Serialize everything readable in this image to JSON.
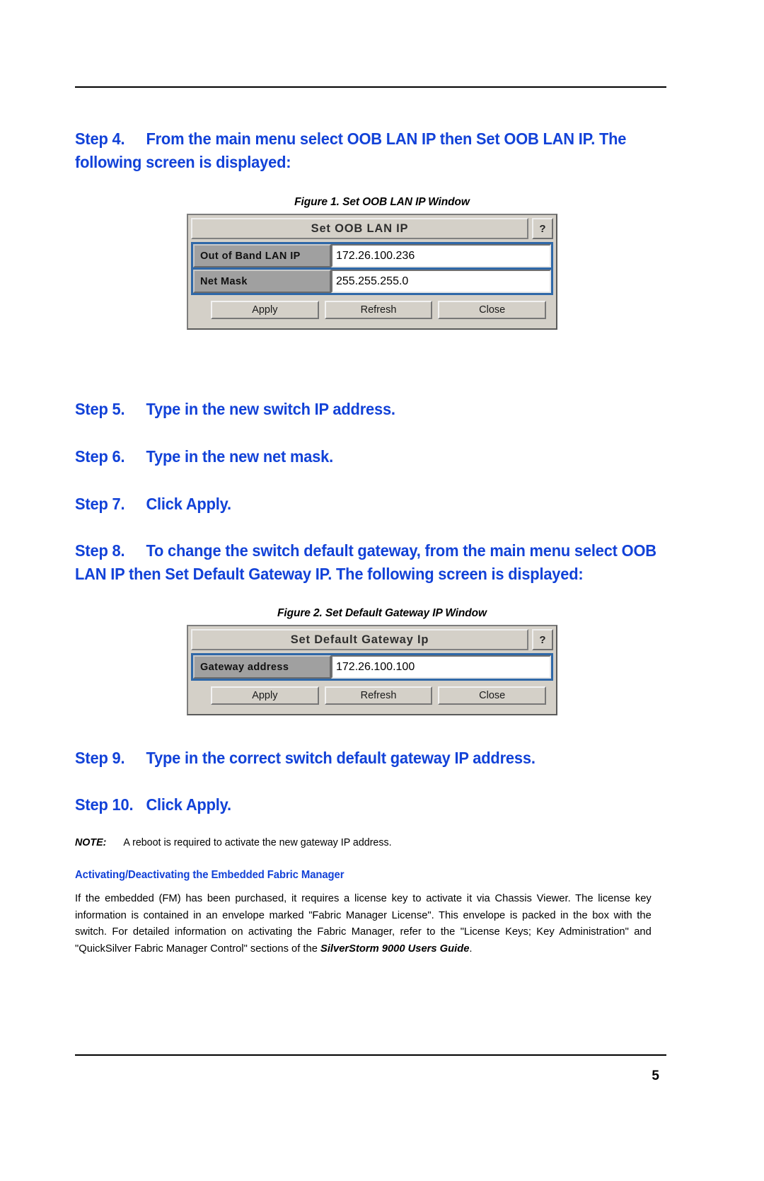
{
  "page": {
    "number": "5"
  },
  "steps": {
    "step4": {
      "label": "Step 4.",
      "text": "From the main menu select OOB LAN IP then Set OOB LAN IP. The following screen is displayed:"
    },
    "step5": {
      "label": "Step 5.",
      "text": "Type in the new switch IP address."
    },
    "step6": {
      "label": "Step 6.",
      "text": "Type in the new net mask."
    },
    "step7": {
      "label": "Step 7.",
      "text": "Click Apply."
    },
    "step8": {
      "label": "Step 8.",
      "text": "To change the switch default gateway, from the main menu select OOB LAN IP then Set Default Gateway IP. The following screen is displayed:"
    },
    "step9": {
      "label": "Step 9.",
      "text": "Type in the correct switch default gateway IP address."
    },
    "step10": {
      "label": "Step 10.",
      "text": "Click Apply."
    }
  },
  "figure1": {
    "caption": "Figure 1. Set OOB LAN IP Window",
    "title": "Set OOB LAN IP",
    "help_label": "?",
    "rows": [
      {
        "label": "Out of Band LAN IP",
        "value": "172.26.100.236"
      },
      {
        "label": "Net Mask",
        "value": "255.255.255.0"
      }
    ],
    "buttons": [
      "Apply",
      "Refresh",
      "Close"
    ]
  },
  "figure2": {
    "caption": "Figure 2. Set Default Gateway IP Window",
    "title": "Set Default Gateway Ip",
    "help_label": "?",
    "rows": [
      {
        "label": "Gateway address",
        "value": "172.26.100.100"
      }
    ],
    "buttons": [
      "Apply",
      "Refresh",
      "Close"
    ]
  },
  "note": {
    "label": "NOTE:",
    "text": "A reboot is required to activate the new gateway IP address."
  },
  "section": {
    "heading": "Activating/Deactivating the Embedded Fabric Manager",
    "paragraph_pre": "If the embedded  (FM) has been purchased, it requires a license key to activate it via Chassis Viewer. The license key information is contained in an envelope marked \"Fabric Manager License\". This envelope is packed in the box with the switch. For detailed information on activating the Fabric Manager, refer to the \"License Keys; Key Administration\" and \"QuickSilver Fabric Manager Control\" sections of the ",
    "paragraph_emphasis": "SilverStorm 9000 Users Guide",
    "paragraph_post": "."
  },
  "colors": {
    "heading_blue": "#1242d8",
    "dialog_face": "#d4d0c8",
    "dialog_form_blue": "#2f68a8",
    "row_label_gray": "#a0a0a0"
  }
}
